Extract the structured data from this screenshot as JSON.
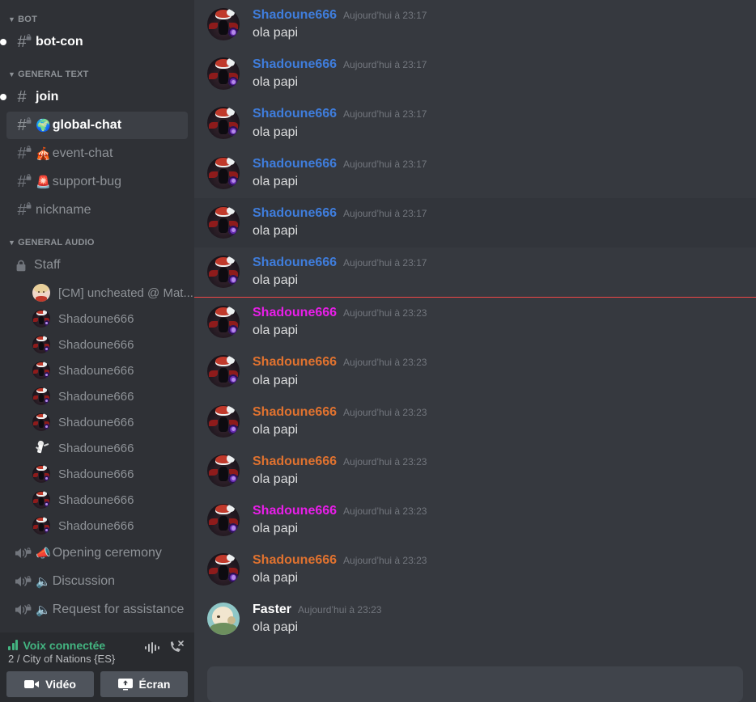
{
  "sidebar": {
    "categories": [
      {
        "label": "BOT",
        "channels": [
          {
            "name": "bot-con",
            "type": "text",
            "locked": true,
            "unread": true,
            "active": false,
            "emoji": ""
          }
        ]
      },
      {
        "label": "GENERAL TEXT",
        "channels": [
          {
            "name": "join",
            "type": "text",
            "locked": false,
            "unread": true,
            "active": false,
            "emoji": ""
          },
          {
            "name": "global-chat",
            "type": "text",
            "locked": true,
            "unread": false,
            "active": true,
            "emoji": "🌍"
          },
          {
            "name": "event-chat",
            "type": "text",
            "locked": true,
            "unread": false,
            "active": false,
            "emoji": "🎪"
          },
          {
            "name": "support-bug",
            "type": "text",
            "locked": true,
            "unread": false,
            "active": false,
            "emoji": "🚨"
          },
          {
            "name": "nickname",
            "type": "text",
            "locked": true,
            "unread": false,
            "active": false,
            "emoji": ""
          }
        ]
      },
      {
        "label": "GENERAL AUDIO",
        "channels": [
          {
            "name": "Staff",
            "type": "voice-locked",
            "locked": true,
            "unread": false,
            "active": false,
            "emoji": ""
          },
          {
            "name": "Opening ceremony",
            "type": "voice",
            "locked": true,
            "unread": false,
            "active": false,
            "emoji": "📣"
          },
          {
            "name": "Discussion",
            "type": "voice",
            "locked": true,
            "unread": false,
            "active": false,
            "emoji": "🔈"
          },
          {
            "name": "Request for assistance",
            "type": "voice",
            "locked": true,
            "unread": false,
            "active": false,
            "emoji": "🔈"
          }
        ]
      }
    ],
    "voice_members": [
      {
        "name": "[CM] uncheated @ Mat...",
        "avatar": "cm"
      },
      {
        "name": "Shadoune666",
        "avatar": "shadow"
      },
      {
        "name": "Shadoune666",
        "avatar": "shadow"
      },
      {
        "name": "Shadoune666",
        "avatar": "shadow"
      },
      {
        "name": "Shadoune666",
        "avatar": "shadow"
      },
      {
        "name": "Shadoune666",
        "avatar": "shadow"
      },
      {
        "name": "Shadoune666",
        "avatar": "runner"
      },
      {
        "name": "Shadoune666",
        "avatar": "shadow"
      },
      {
        "name": "Shadoune666",
        "avatar": "shadow"
      },
      {
        "name": "Shadoune666",
        "avatar": "shadow"
      }
    ],
    "voice_panel": {
      "status": "Voix connectée",
      "detail": "2 / City of Nations {ES}",
      "signal_icon": "signal-waveform-icon",
      "disconnect_icon": "disconnect-call-icon",
      "video_label": "Vidéo",
      "screen_label": "Écran",
      "status_color": "#43b581"
    }
  },
  "main": {
    "new_messages_divider": true,
    "input_placeholder": "",
    "messages": [
      {
        "author": "Shadoune666",
        "color": "#3f7ddc",
        "time": "Aujourd’hui à 23:17",
        "text": "ola papi",
        "avatar": "shadow",
        "highlight": false
      },
      {
        "author": "Shadoune666",
        "color": "#3f7ddc",
        "time": "Aujourd’hui à 23:17",
        "text": "ola papi",
        "avatar": "shadow",
        "highlight": false
      },
      {
        "author": "Shadoune666",
        "color": "#3f7ddc",
        "time": "Aujourd’hui à 23:17",
        "text": "ola papi",
        "avatar": "shadow",
        "highlight": false
      },
      {
        "author": "Shadoune666",
        "color": "#3f7ddc",
        "time": "Aujourd’hui à 23:17",
        "text": "ola papi",
        "avatar": "shadow",
        "highlight": false
      },
      {
        "author": "Shadoune666",
        "color": "#3f7ddc",
        "time": "Aujourd’hui à 23:17",
        "text": "ola papi",
        "avatar": "shadow",
        "highlight": true
      },
      {
        "author": "Shadoune666",
        "color": "#3f7ddc",
        "time": "Aujourd’hui à 23:17",
        "text": "ola papi",
        "avatar": "shadow",
        "highlight": false
      },
      {
        "author": "Shadoune666",
        "color": "#e91ee9",
        "time": "Aujourd’hui à 23:23",
        "text": "ola papi",
        "avatar": "shadow",
        "highlight": false
      },
      {
        "author": "Shadoune666",
        "color": "#e0722f",
        "time": "Aujourd’hui à 23:23",
        "text": "ola papi",
        "avatar": "shadow",
        "highlight": false
      },
      {
        "author": "Shadoune666",
        "color": "#e0722f",
        "time": "Aujourd’hui à 23:23",
        "text": "ola papi",
        "avatar": "shadow",
        "highlight": false
      },
      {
        "author": "Shadoune666",
        "color": "#e0722f",
        "time": "Aujourd’hui à 23:23",
        "text": "ola papi",
        "avatar": "shadow",
        "highlight": false
      },
      {
        "author": "Shadoune666",
        "color": "#e91ee9",
        "time": "Aujourd’hui à 23:23",
        "text": "ola papi",
        "avatar": "shadow",
        "highlight": false
      },
      {
        "author": "Shadoune666",
        "color": "#e0722f",
        "time": "Aujourd’hui à 23:23",
        "text": "ola papi",
        "avatar": "shadow",
        "highlight": false
      },
      {
        "author": "Faster",
        "color": "#ffffff",
        "time": "Aujourd’hui à 23:23",
        "text": "ola papi",
        "avatar": "faster",
        "highlight": false
      }
    ]
  }
}
